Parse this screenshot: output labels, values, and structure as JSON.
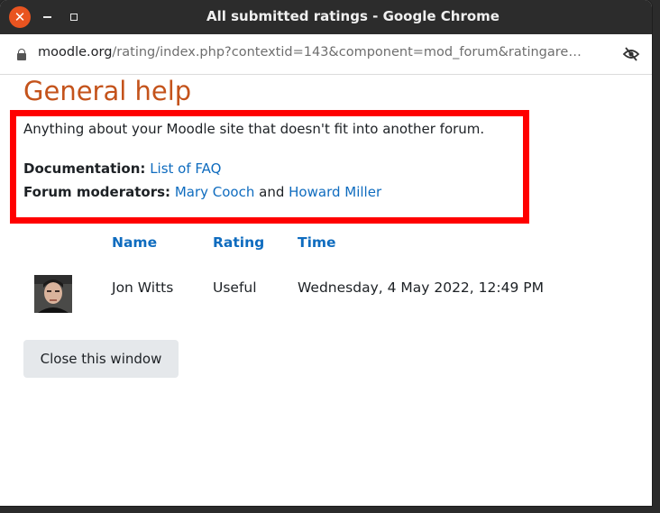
{
  "window": {
    "title": "All submitted ratings - Google Chrome",
    "close_glyph": "✕"
  },
  "address_bar": {
    "host": "moodle.org",
    "path": "/rating/index.php?contextid=143&component=mod_forum&ratingare…",
    "icons": [
      "lock-icon",
      "eye-off-icon"
    ]
  },
  "forum": {
    "title": "General help",
    "description": "Anything about your Moodle site that doesn't fit into another forum.",
    "documentation_label": "Documentation:",
    "documentation_link": "List of FAQ",
    "moderators_label": "Forum moderators:",
    "moderator_1": "Mary Cooch",
    "and_text": "and",
    "moderator_2": "Howard Miller"
  },
  "ratings_table": {
    "headers": [
      "Name",
      "Rating",
      "Time"
    ],
    "rows": [
      {
        "name": "Jon Witts",
        "rating": "Useful",
        "time": "Wednesday, 4 May 2022, 12:49 PM"
      }
    ]
  },
  "close_button_label": "Close this window",
  "colors": {
    "accent": "#c4531b",
    "link": "#0f6cbf",
    "highlight_border": "#ff0000"
  }
}
